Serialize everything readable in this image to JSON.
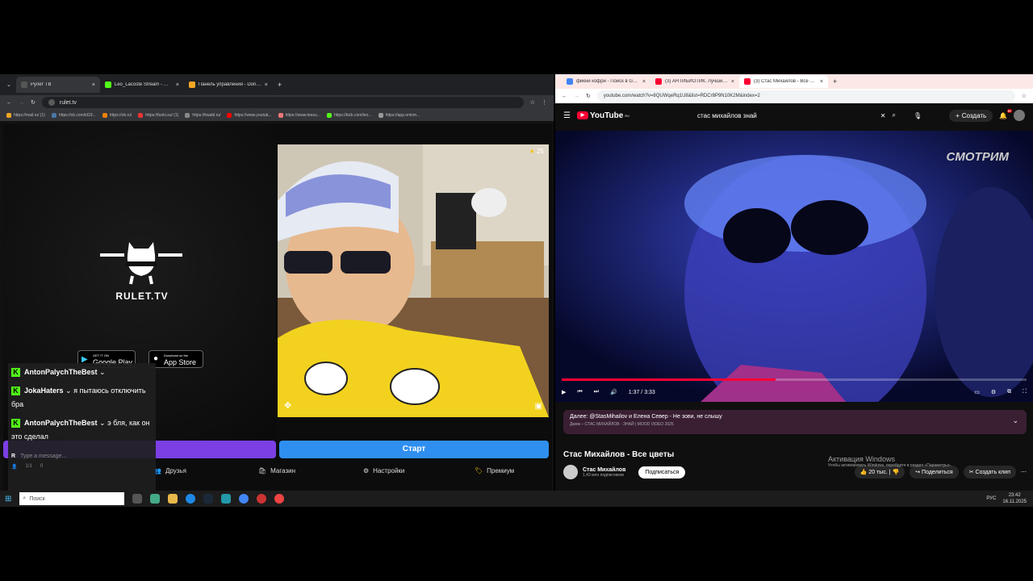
{
  "left_browser": {
    "tabs": [
      {
        "title": "Рулет ТВ",
        "active": true
      },
      {
        "title": "Leo_Lacoste Stream - Watch Li...",
        "active": false
      },
      {
        "title": "Панель управления - Donatio...",
        "active": false
      }
    ],
    "url": "rulet.tv",
    "bookmarks": [
      "https://mail.ru/ (1)",
      "https://vk.com/id19...",
      "https://ok.ru/",
      "https://funki.su/ (1)",
      "https://kwabl.ru/",
      "https://www.youtub...",
      "https://www.teesu...",
      "https://kick.com/leo...",
      "https://app.onlom..."
    ]
  },
  "rulet": {
    "logo_text": "RULET.TV",
    "google_play": {
      "small": "GET IT ON",
      "big": "Google Play"
    },
    "app_store": {
      "small": "Download on the",
      "big": "App Store"
    },
    "stars": "25",
    "start_button": "Старт",
    "nav": [
      {
        "label": "Друзья",
        "icon": "friends-icon"
      },
      {
        "label": "Магазин",
        "icon": "shop-icon"
      },
      {
        "label": "Настройки",
        "icon": "settings-icon"
      },
      {
        "label": "Премиум",
        "icon": "premium-icon"
      }
    ]
  },
  "chat": {
    "messages": [
      {
        "user": "AntonPalychTheBest",
        "text": ""
      },
      {
        "user": "JokaHaters",
        "text": "я пытаюсь отключить бра"
      },
      {
        "user": "AntonPalychTheBest",
        "text": "э бля, как он это сделал"
      }
    ],
    "input_placeholder": "Type a message...",
    "viewers": "1/1",
    "count": "0"
  },
  "youtube": {
    "tabs": [
      {
        "title": "фикни кофри - Поиск в Google",
        "active": false
      },
      {
        "title": "(3) АНТИБИОТИК. Лучшие кл...",
        "active": false
      },
      {
        "title": "(3) Стас Михайлов - Все цветы",
        "active": true
      }
    ],
    "url": "youtube.com/watch?v=8QUWqeRq1U8&list=RDCr8P9N10K2M&index=2",
    "logo": "YouTube",
    "logo_region": "RU",
    "search_query": "стас михайлов знай",
    "create_label": "Создать",
    "notif_count": "9+",
    "watermark": "СМОТРИМ",
    "time": "1:37 / 3:33",
    "progress": 0.46,
    "up_next_title": "Далее: @StasMihailov и Елена Север - Не зови, не слышу",
    "up_next_sub": "Джем – СТАС МИХАЙЛОВ · ЗНАЙ | MOOD VIDEO 2025",
    "video_title": "Стас Михайлов - Все цветы",
    "channel": "Стас Михайлов",
    "subscribers": "1,43 млн подписчиков",
    "subscribe": "Подписаться",
    "likes": "20 тыс.",
    "share": "Поделиться",
    "clip": "Создать клип",
    "activation": "Активация Windows",
    "activation_sub": "Чтобы активировать Windows, перейдите в раздел «Параметры»."
  },
  "taskbar": {
    "search": "Поиск",
    "lang": "РУС",
    "time": "23:42",
    "date": "16.11.2025"
  },
  "colors": {
    "purple": "#7b3fe4",
    "blue": "#2f8ff0",
    "yt_red": "#ff0033",
    "kick_green": "#53fc18"
  }
}
